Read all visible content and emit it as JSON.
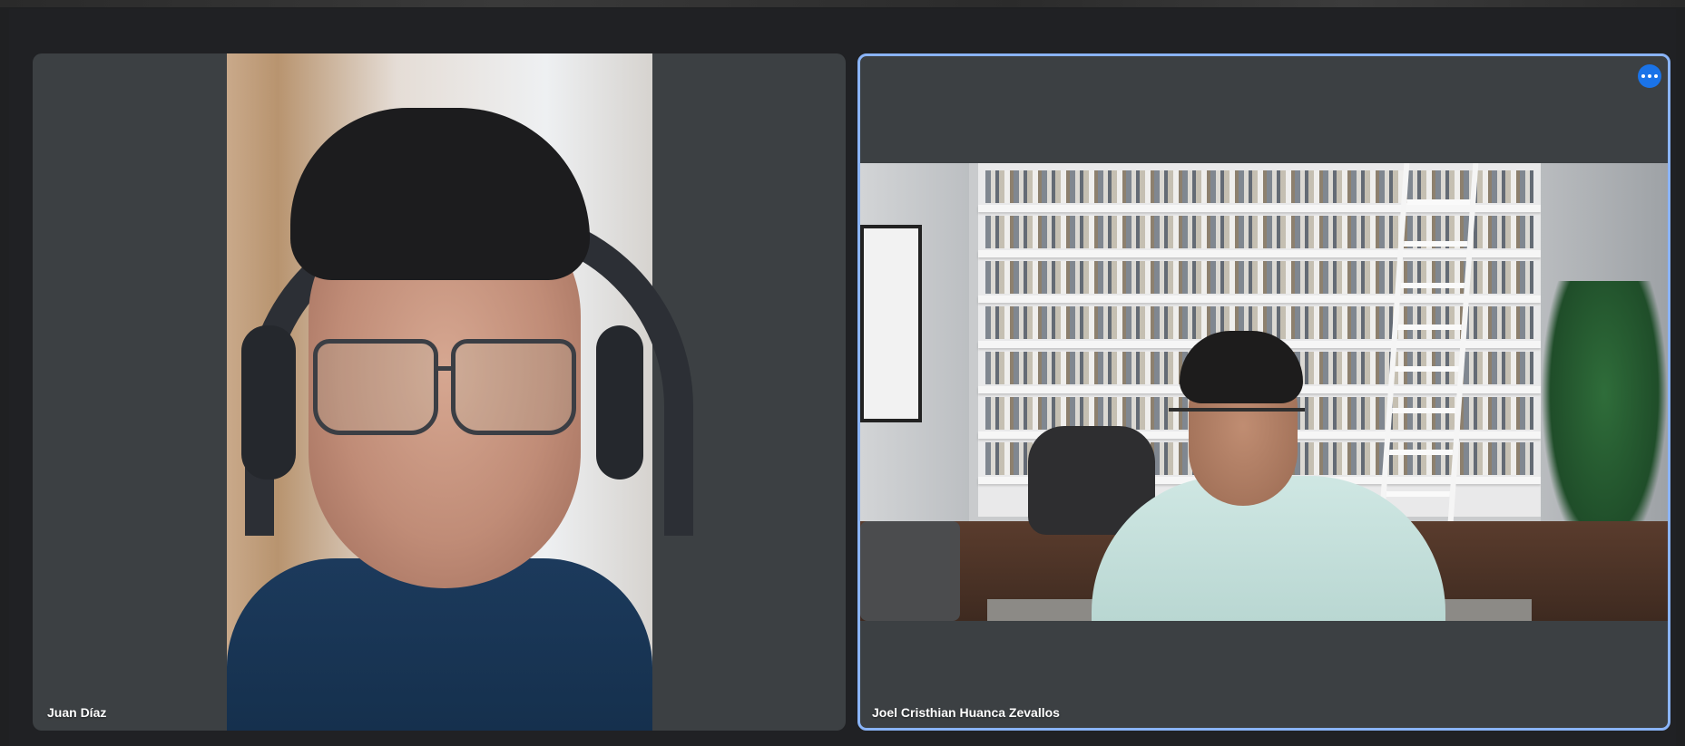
{
  "window": {
    "accent_color": "#8ab4f8",
    "tile_bg": "#3c4043",
    "page_bg": "#202124"
  },
  "participants": [
    {
      "name": "Juan Díaz",
      "video": "camera-feed",
      "pinned": false
    },
    {
      "name": "Joel Cristhian Huanca Zevallos",
      "video": "camera-feed-virtual-background",
      "active_speaker": true
    }
  ],
  "controls": {
    "more_options_icon": "more-horizontal-icon"
  }
}
